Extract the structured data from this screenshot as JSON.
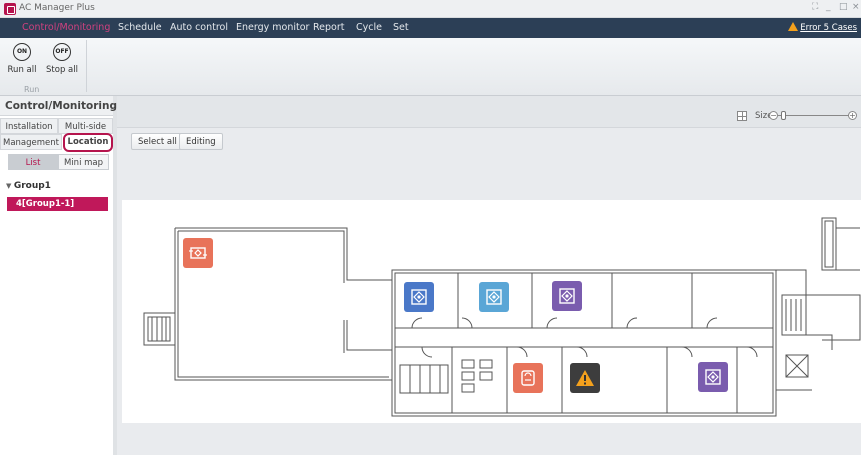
{
  "app": {
    "title": "AC Manager Plus"
  },
  "window_controls": {
    "restore": "⛶",
    "minimize": "_",
    "maximize": "□",
    "close": "×"
  },
  "menu": {
    "items": [
      "Control/Monitoring",
      "Schedule",
      "Auto control",
      "Energy monitor",
      "Report",
      "Cycle",
      "Set"
    ],
    "error_text": "Error 5 Cases"
  },
  "ribbon": {
    "run_all": {
      "icon_text": "ON",
      "label": "Run all"
    },
    "stop_all": {
      "icon_text": "OFF",
      "label": "Stop all"
    },
    "group_label": "Run"
  },
  "sidebar": {
    "title": "Control/Monitoring",
    "tabs": [
      "Installation",
      "Multi-side",
      "Management",
      "Location"
    ],
    "views": [
      "List",
      "Mini map"
    ],
    "tree": {
      "group": "Group1",
      "item": "4[Group1-1]"
    }
  },
  "toolbar": {
    "select_all": "Select all",
    "editing": "Editing"
  },
  "size_control": {
    "label": "Size",
    "minus": "−",
    "plus": "+"
  },
  "colors": {
    "accent": "#b5144d",
    "menu_bg": "#2c3f56",
    "ventilator": "#e8735a",
    "cassette_blue": "#4a78c8",
    "cassette_light_blue": "#5aa6d6",
    "cassette_purple": "#7a5cae",
    "warning_bg": "#3d3d3d",
    "warning": "#f4a11d"
  },
  "units": [
    {
      "name": "ventilator-unit",
      "icon": "ventilation-icon",
      "color": "ventilator"
    },
    {
      "name": "ac-unit-blue",
      "icon": "cassette-icon",
      "color": "cassette_blue"
    },
    {
      "name": "ac-unit-light-blue",
      "icon": "cassette-icon",
      "color": "cassette_light_blue"
    },
    {
      "name": "ac-unit-purple",
      "icon": "cassette-icon",
      "color": "cassette_purple"
    },
    {
      "name": "ac-unit-orange",
      "icon": "floor-unit-icon",
      "color": "ventilator"
    },
    {
      "name": "ac-unit-error",
      "icon": "warning-icon",
      "color": "warning_bg"
    },
    {
      "name": "ac-unit-purple-2",
      "icon": "cassette-icon",
      "color": "cassette_purple"
    }
  ]
}
